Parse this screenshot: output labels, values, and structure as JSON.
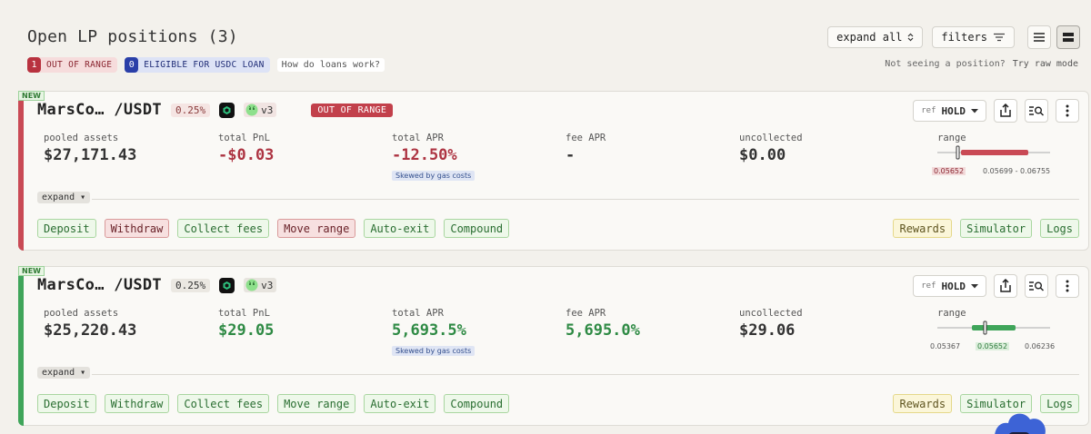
{
  "header": {
    "title": "Open LP positions (3)",
    "expand_all_label": "expand all",
    "filters_label": "filters"
  },
  "subheader": {
    "out_of_range_count": "1",
    "out_of_range_label": "OUT OF RANGE",
    "eligible_count": "0",
    "eligible_label": "ELIGIBLE FOR USDC LOAN",
    "loans_link": "How do loans work?",
    "not_seeing": "Not seeing a position?",
    "raw_mode": "Try raw mode"
  },
  "positions": [
    {
      "new_tag": "NEW",
      "pair": "MarsCo… /USDT",
      "fee_tier": "0.25%",
      "version": "v3",
      "status": "OUT OF RANGE",
      "ref_label": "ref",
      "ref_value": "HOLD",
      "pooled_label": "pooled assets",
      "pooled_value": "$27,171.43",
      "pnl_label": "total PnL",
      "pnl_value": "-$0.03",
      "apr_label": "total APR",
      "apr_value": "-12.50%",
      "apr_note": "Skewed by gas costs",
      "fee_apr_label": "fee APR",
      "fee_apr_value": "-",
      "uncollected_label": "uncollected",
      "uncollected_value": "$0.00",
      "range_label": "range",
      "range_current": "0.05652",
      "range_bounds": "0.05699 - 0.06755",
      "expand_label": "expand",
      "buttons": {
        "deposit": "Deposit",
        "withdraw": "Withdraw",
        "collect": "Collect fees",
        "move": "Move range",
        "autoexit": "Auto-exit",
        "compound": "Compound",
        "rewards": "Rewards",
        "simulator": "Simulator",
        "logs": "Logs"
      }
    },
    {
      "new_tag": "NEW",
      "pair": "MarsCo… /USDT",
      "fee_tier": "0.25%",
      "version": "v3",
      "ref_label": "ref",
      "ref_value": "HOLD",
      "pooled_label": "pooled assets",
      "pooled_value": "$25,220.43",
      "pnl_label": "total PnL",
      "pnl_value": "$29.05",
      "apr_label": "total APR",
      "apr_value": "5,693.5%",
      "apr_note": "Skewed by gas costs",
      "fee_apr_label": "fee APR",
      "fee_apr_value": "5,695.0%",
      "uncollected_label": "uncollected",
      "uncollected_value": "$29.06",
      "range_label": "range",
      "range_low": "0.05367",
      "range_current": "0.05652",
      "range_high": "0.06236",
      "expand_label": "expand",
      "buttons": {
        "deposit": "Deposit",
        "withdraw": "Withdraw",
        "collect": "Collect fees",
        "move": "Move range",
        "autoexit": "Auto-exit",
        "compound": "Compound",
        "rewards": "Rewards",
        "simulator": "Simulator",
        "logs": "Logs"
      }
    }
  ],
  "colors": {
    "accent_red": "#c94a55",
    "accent_green": "#3fa55a",
    "loan_blue": "#2a3fa8"
  }
}
